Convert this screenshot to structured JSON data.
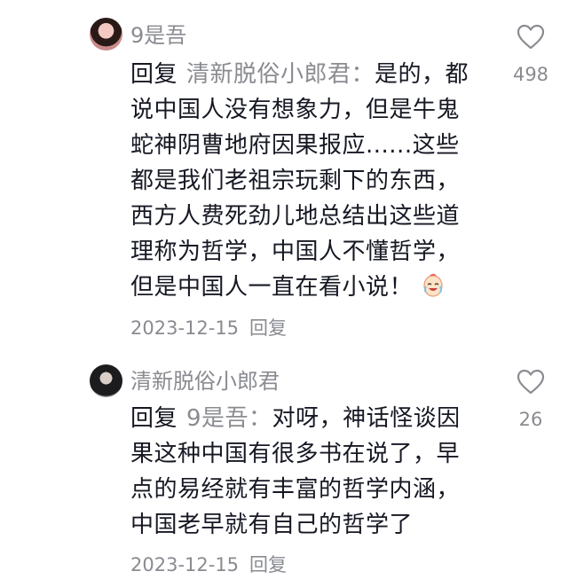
{
  "comments": [
    {
      "username": "9是吾",
      "reply_label": "回复",
      "reply_target": "清新脱俗小郎君：",
      "text": "是的，都说中国人没有想象力，但是牛鬼蛇神阴曹地府因果报应......这些都是我们老祖宗玩剩下的东西，西方人费死劲儿地总结出这些道理称为哲学，中国人不懂哲学，但是中国人一直在看小说！",
      "emoji": "laughing-crying-emoji",
      "date": "2023-12-15",
      "reply_button": "回复",
      "likes": "498"
    },
    {
      "username": "清新脱俗小郎君",
      "reply_label": "回复",
      "reply_target": "9是吾：",
      "text": "对呀，神话怪谈因果这种中国有很多书在说了，早点的易经就有丰富的哲学内涵，中国老早就有自己的哲学了",
      "date": "2023-12-15",
      "reply_button": "回复",
      "likes": "26"
    }
  ],
  "icons": {
    "like": "heart-outline-icon",
    "avatar": "user-avatar"
  },
  "colors": {
    "text": "#161823",
    "muted": "#8a8b91",
    "background": "#ffffff"
  }
}
